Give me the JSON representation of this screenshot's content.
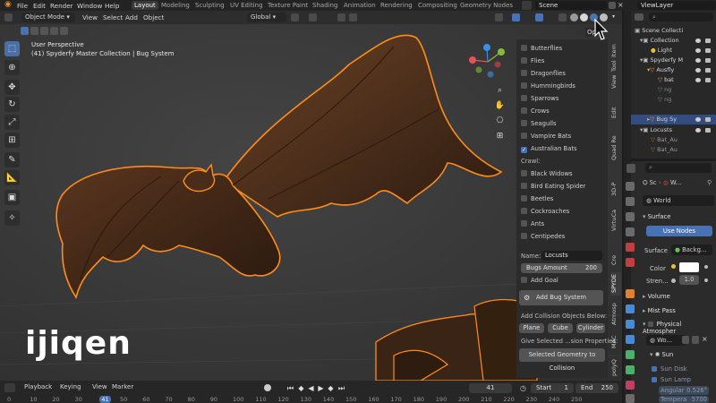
{
  "topbar": {
    "menu": [
      "File",
      "Edit",
      "Render",
      "Window",
      "Help"
    ],
    "workspaces": [
      "Layout",
      "Modeling",
      "Sculpting",
      "UV Editing",
      "Texture Paint",
      "Shading",
      "Animation",
      "Rendering",
      "Compositing",
      "Geometry Nodes"
    ],
    "active_workspace": "Layout",
    "scene": "Scene",
    "view_layer": "ViewLayer"
  },
  "viewport_header": {
    "mode": "Object Mode",
    "menus": [
      "View",
      "Select",
      "Add",
      "Object"
    ],
    "transform": "Global",
    "options_label": "Op"
  },
  "viewport": {
    "perspective": "User Perspective",
    "collection_info": "(41) Spyderfy Master Collection | Bug System",
    "watermark": "ijiqen"
  },
  "bug_panel": {
    "flyers": [
      {
        "label": "Butterflies",
        "checked": false
      },
      {
        "label": "Flies",
        "checked": false
      },
      {
        "label": "Dragonflies",
        "checked": false
      },
      {
        "label": "Hummingbirds",
        "checked": false
      },
      {
        "label": "Sparrows",
        "checked": false
      },
      {
        "label": "Crows",
        "checked": false
      },
      {
        "label": "Seagulls",
        "checked": false
      },
      {
        "label": "Vampire Bats",
        "checked": false
      },
      {
        "label": "Australian Bats",
        "checked": true
      }
    ],
    "crawl_label": "Crawl:",
    "crawlers": [
      {
        "label": "Black Widows",
        "checked": false
      },
      {
        "label": "Bird Eating Spider",
        "checked": false
      },
      {
        "label": "Beetles",
        "checked": false
      },
      {
        "label": "Cockroaches",
        "checked": false
      },
      {
        "label": "Ants",
        "checked": false
      },
      {
        "label": "Centipedes",
        "checked": false
      }
    ],
    "name_label": "Name:",
    "name_value": "Locusts",
    "bugs_amount_label": "Bugs Amount",
    "bugs_amount_value": "200",
    "add_goal": "Add Goal",
    "add_bug_system": "Add Bug System",
    "collision_heading": "Add Collision Objects Below:",
    "collision_buttons": [
      "Plane",
      "Cube",
      "Cylinder"
    ],
    "give_selected": "Give Selected ...sion Properties:",
    "selected_geometry": "Selected Geometry to Collision"
  },
  "side_tabs": [
    "Item",
    "Tool",
    "View",
    "Edit",
    "Quad Re",
    "3D-P",
    "VirtuCa",
    "Cre",
    "SPYDE",
    "Atmosp",
    "MAC",
    "polyQ"
  ],
  "outliner": {
    "rows": [
      {
        "label": "Scene Collecti",
        "indent": 0
      },
      {
        "label": "Collection",
        "indent": 1
      },
      {
        "label": "Light",
        "indent": 2
      },
      {
        "label": "Spyderfy M",
        "indent": 1
      },
      {
        "label": "Ausfly",
        "indent": 2
      },
      {
        "label": "bat",
        "indent": 3
      },
      {
        "label": "ng",
        "indent": 3
      },
      {
        "label": "ng",
        "indent": 3
      },
      {
        "label": "Bug Sy",
        "indent": 2,
        "selected": true
      },
      {
        "label": "Locusts",
        "indent": 1
      },
      {
        "label": "Bat_Au",
        "indent": 2
      },
      {
        "label": "Bat_Au",
        "indent": 2
      }
    ]
  },
  "properties": {
    "breadcrumb_scene": "Sc",
    "breadcrumb_world": "W...",
    "world_name": "World",
    "surface_section": "Surface",
    "use_nodes": "Use Nodes",
    "surface_label": "Surface",
    "surface_value": "Backg...",
    "color_label": "Color",
    "strength_label": "Stren...",
    "strength_value": "1.0",
    "volume_section": "Volume",
    "mist_section": "Mist Pass",
    "atmos_section": "Physical Atmospher",
    "wo_field": "Wo...",
    "sun_section": "Sun",
    "sun_disk": "Sun Disk",
    "sun_lamp": "Sun Lamp",
    "angular_label": "Angular",
    "angular_value": "0.526°",
    "temp_label": "Tempera",
    "temp_value": "5700"
  },
  "timeline": {
    "menus": [
      "Playback",
      "Keying",
      "View",
      "Marker"
    ],
    "current_frame": "41",
    "start_label": "Start",
    "start_value": "1",
    "end_label": "End",
    "end_value": "250",
    "ticks": [
      "0",
      "10",
      "20",
      "30",
      "41",
      "50",
      "60",
      "70",
      "80",
      "90",
      "100",
      "110",
      "120",
      "130",
      "140",
      "150",
      "160",
      "170",
      "180",
      "190",
      "200",
      "210",
      "220",
      "230",
      "240",
      "250"
    ]
  },
  "colors": {
    "accent": "#4772b3",
    "selection_outline": "#ff8c1a",
    "viewport_bg": "#3b3b3b"
  }
}
